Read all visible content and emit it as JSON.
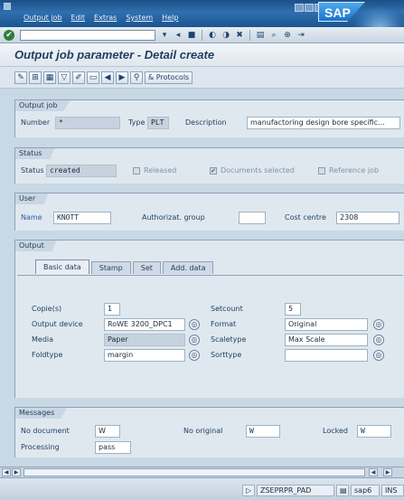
{
  "menu": {
    "items": [
      "Output job",
      "Edit",
      "Extras",
      "System",
      "Help"
    ]
  },
  "brand": {
    "logo_text": "SAP"
  },
  "toolbar": {
    "ok_symbol": "✔"
  },
  "screen": {
    "title": "Output job parameter - Detail create"
  },
  "app_toolbar": {
    "protocols_label": "Protocols"
  },
  "output_job": {
    "title": "Output job",
    "number_label": "Number",
    "number_value": "*",
    "type_label": "Type",
    "type_value": "PLT",
    "description_label": "Description",
    "description_value": "manufactoring design bore specific..."
  },
  "status": {
    "title": "Status",
    "status_label": "Status",
    "status_value": "created",
    "released_label": "Released",
    "documents_selected_label": "Documents selected",
    "reference_job_label": "Reference job",
    "released_checked": false,
    "documents_selected_checked": true,
    "reference_job_checked": false
  },
  "user": {
    "title": "User",
    "name_label": "Name",
    "name_value": "KNOTT",
    "authorizat_group_label": "Authorizat. group",
    "authorizat_group_value": "",
    "cost_centre_label": "Cost centre",
    "cost_centre_value": "2308"
  },
  "output": {
    "title": "Output",
    "tabs": [
      {
        "label": "Basic data",
        "active": true
      },
      {
        "label": "Stamp",
        "active": false
      },
      {
        "label": "Set",
        "active": false
      },
      {
        "label": "Add. data",
        "active": false
      }
    ],
    "copies_label": "Copie(s)",
    "copies_value": "1",
    "output_device_label": "Output device",
    "output_device_value": "RoWE 3200_DPC1",
    "media_label": "Media",
    "media_value": "Paper",
    "foldtype_label": "Foldtype",
    "foldtype_value": "margin",
    "setcount_label": "Setcount",
    "setcount_value": "5",
    "format_label": "Format",
    "format_value": "Original",
    "scaletype_label": "Scaletype",
    "scaletype_value": "Max Scale",
    "sorttype_label": "Sorttype",
    "sorttype_value": ""
  },
  "messages": {
    "title": "Messages",
    "no_document_label": "No document",
    "no_document_value": "W",
    "no_original_label": "No original",
    "no_original_value": "W",
    "locked_label": "Locked",
    "locked_value": "W",
    "processing_label": "Processing",
    "processing_value": "pass"
  },
  "statusbar": {
    "program": "ZSEPRPR_PAD",
    "server": "sap6",
    "mode": "INS"
  },
  "colors": {
    "accent": "#1d4f86",
    "background": "#c8d8e4",
    "ok_green": "#2e7d3a"
  },
  "icons": [
    "ok-icon",
    "save-icon",
    "back-icon",
    "exit-icon",
    "cancel-icon",
    "print-icon",
    "find-icon",
    "help-icon",
    "next-icon",
    "previous-icon"
  ]
}
